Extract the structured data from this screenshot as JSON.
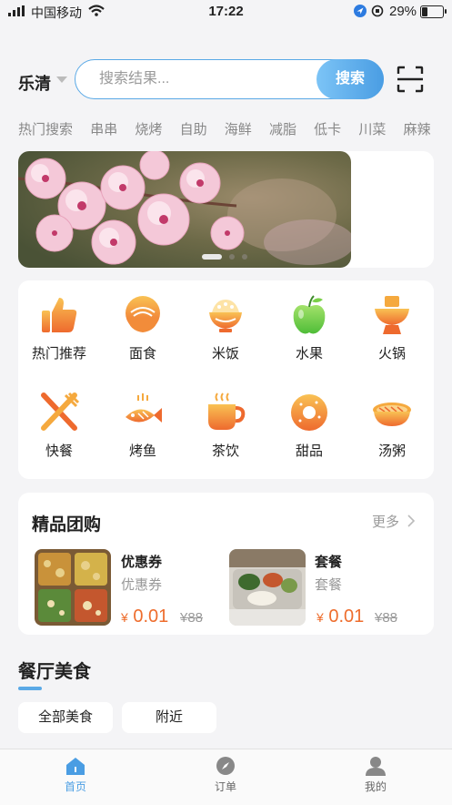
{
  "status_bar": {
    "carrier": "中国移动",
    "time": "17:22",
    "battery": "29%",
    "battery_level": 0.29
  },
  "header": {
    "city": "乐清",
    "search_placeholder": "搜索结果...",
    "search_button": "搜索",
    "scan_icon": "scan-icon"
  },
  "hot_search": {
    "label": "热门搜索",
    "terms": [
      "串串",
      "烧烤",
      "自助",
      "海鲜",
      "减脂",
      "低卡",
      "川菜",
      "麻辣"
    ]
  },
  "banner": {
    "image": "plum-blossom-photo",
    "slides": 3,
    "active_slide": 1
  },
  "categories": [
    {
      "label": "热门推荐",
      "icon": "thumbs-up-icon"
    },
    {
      "label": "面食",
      "icon": "noodle-bowl-icon"
    },
    {
      "label": "米饭",
      "icon": "rice-bowl-icon"
    },
    {
      "label": "水果",
      "icon": "apple-icon"
    },
    {
      "label": "火锅",
      "icon": "hotpot-icon"
    },
    {
      "label": "快餐",
      "icon": "fork-knife-icon"
    },
    {
      "label": "烤鱼",
      "icon": "grilled-fish-icon"
    },
    {
      "label": "茶饮",
      "icon": "tea-cup-icon"
    },
    {
      "label": "甜品",
      "icon": "donut-icon"
    },
    {
      "label": "汤粥",
      "icon": "soup-bowl-icon"
    }
  ],
  "group_deals": {
    "title": "精品团购",
    "more": "更多",
    "items": [
      {
        "name": "优惠券",
        "subtitle": "优惠券",
        "currency": "¥",
        "price": "0.01",
        "old_price": "¥88"
      },
      {
        "name": "套餐",
        "subtitle": "套餐",
        "currency": "¥",
        "price": "0.01",
        "old_price": "¥88"
      }
    ]
  },
  "restaurants": {
    "title": "餐厅美食",
    "filters": [
      "全部美食",
      "附近"
    ]
  },
  "tabbar": {
    "tabs": [
      {
        "label": "首页",
        "icon": "home-icon",
        "active": true
      },
      {
        "label": "订单",
        "icon": "compass-icon",
        "active": false
      },
      {
        "label": "我的",
        "icon": "user-icon",
        "active": false
      }
    ]
  },
  "colors": {
    "accent": "#4a9de3",
    "price": "#ee6d2d",
    "icon_orange": "#f08a3c"
  }
}
